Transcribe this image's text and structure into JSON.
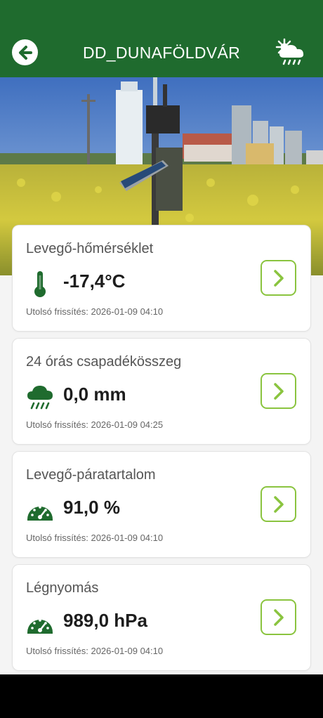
{
  "header": {
    "title": "DD_DUNAFÖLDVÁR",
    "back_icon": "arrow-left-icon",
    "weather_icon": "sun-cloud-rain-icon",
    "background_color": "#1f6b2e"
  },
  "hero": {
    "image": "weather station in rapeseed field with grain silos"
  },
  "cards": [
    {
      "title": "Levegő-hőmérséklet",
      "icon": "thermometer-icon",
      "value": "-17,4°C",
      "updated": "Utolsó frissítés: 2026-01-09 04:10"
    },
    {
      "title": "24 órás csapadékösszeg",
      "icon": "rain-cloud-icon",
      "value": "0,0 mm",
      "updated": "Utolsó frissítés: 2026-01-09 04:25"
    },
    {
      "title": "Levegő-páratartalom",
      "icon": "gauge-icon",
      "value": "91,0 %",
      "updated": "Utolsó frissítés: 2026-01-09 04:10"
    },
    {
      "title": "Légnyomás",
      "icon": "gauge-icon",
      "value": "989,0 hPa",
      "updated": "Utolsó frissítés: 2026-01-09 04:10"
    }
  ],
  "colors": {
    "icon_green": "#1f6b2e",
    "arrow_green": "#8ac43f"
  }
}
